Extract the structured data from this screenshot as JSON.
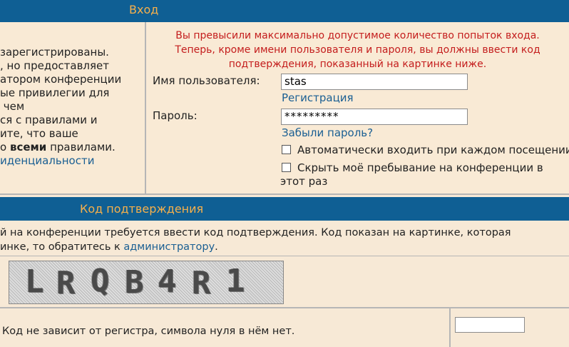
{
  "login_header": {
    "title": "Вход"
  },
  "left_text": {
    "lines": [
      "зарегистрированы.",
      ", но предоставляет",
      "атором конференции",
      "ые привилегии для",
      " чем",
      "ся с правилами и",
      "ите, что ваше"
    ],
    "last_line_prefix": "о",
    "last_line_bold": "всеми",
    "last_line_suffix": "правилами.",
    "privacy_link": "иденциальности"
  },
  "error_message": {
    "line1": "Вы превысили максимально допустимое количество попыток входа.",
    "line2": "Теперь, кроме имени пользователя и пароля, вы должны ввести код",
    "line3": "подтверждения, показанный на картинке ниже."
  },
  "form": {
    "username_label": "Имя пользователя:",
    "username_value": "stas",
    "register_link": "Регистрация",
    "password_label": "Пароль:",
    "password_value": "*********",
    "forgot_link": "Забыли пароль?",
    "auto_login_label": "Автоматически входить при каждом посещении",
    "hide_presence_line1": "Скрыть моё пребывание на конференции в",
    "hide_presence_line2": "этот раз"
  },
  "confirm_header": {
    "title": "Код подтверждения"
  },
  "confirm_text": {
    "line1": "й на конференции требуется ввести код подтверждения. Код показан на картинке, которая",
    "line2_prefix": "инке, то обратитесь к",
    "admin_link": "администратору",
    "line2_suffix": "."
  },
  "captcha": {
    "chars": [
      "L",
      "R",
      "Q",
      "B",
      "4",
      "R",
      "1"
    ]
  },
  "code_hint": "Код не зависит от регистра, символа нуля в нём нет.",
  "code_input_value": ""
}
